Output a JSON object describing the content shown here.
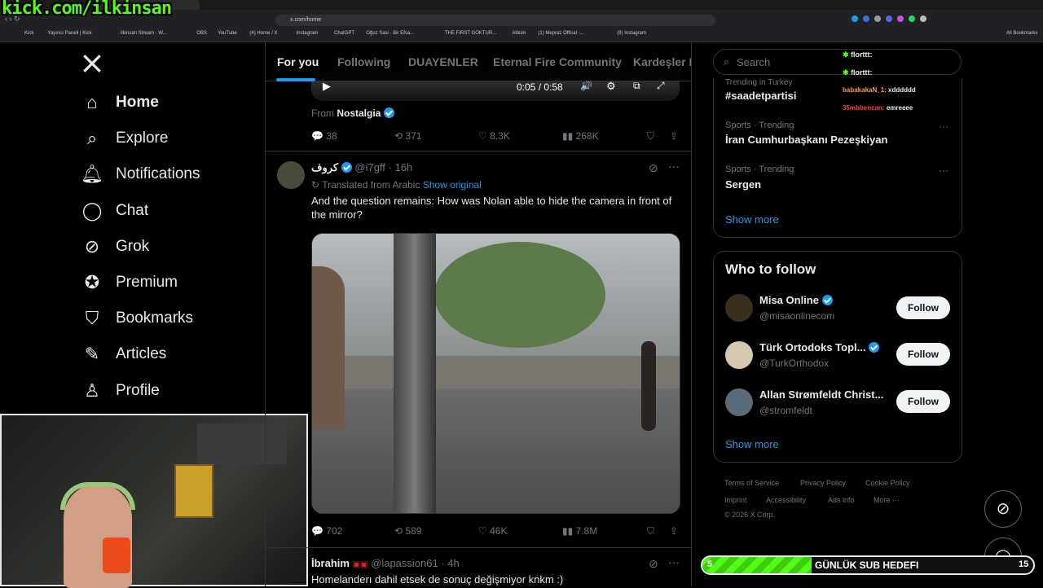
{
  "overlay": {
    "stream_url": "kick.com/ilkinsan",
    "chat_lines": [
      {
        "user": "florttt:",
        "msg": ""
      },
      {
        "user": "florttt:",
        "msg": ""
      },
      {
        "user": "babakakaN_1:",
        "msg": "xdddddd"
      },
      {
        "user": "35mbbencan:",
        "msg": "emreeee"
      }
    ],
    "goal_start": "5",
    "goal_label": "GÜNLÜK SUB HEDEFI",
    "goal_end": "15",
    "goal_progress": 0.33
  },
  "browser": {
    "url": "x.com/home",
    "bookmarks": [
      "Kick",
      "Yayıncı Paneli | Kick",
      "ilkinsan Stream - W...",
      "OBS",
      "YouTube",
      "(4) Home / X",
      "Instagram",
      "ChatGPT",
      "Oğuz Sasi - Bir Efsa...",
      "THE FIRST GOKTUR...",
      "Albüm",
      "(1) Mepraz Offical -...",
      "(9) Instagram"
    ],
    "all_bookmarks": "All Bookmarks"
  },
  "nav": {
    "items": [
      {
        "label": "Home",
        "icon": "home-icon"
      },
      {
        "label": "Explore",
        "icon": "search-icon"
      },
      {
        "label": "Notifications",
        "icon": "bell-icon"
      },
      {
        "label": "Chat",
        "icon": "chat-icon"
      },
      {
        "label": "Grok",
        "icon": "grok-icon"
      },
      {
        "label": "Premium",
        "icon": "premium-icon"
      },
      {
        "label": "Bookmarks",
        "icon": "bookmark-icon"
      },
      {
        "label": "Articles",
        "icon": "articles-icon"
      },
      {
        "label": "Profile",
        "icon": "profile-icon"
      }
    ]
  },
  "tabs": [
    "For you",
    "Following",
    "DUAYENLER",
    "Eternal Fire Community",
    "Kardeşler K"
  ],
  "tweet1": {
    "video_time": "0:05 / 0:58",
    "from_label": "From",
    "from_name": "Nostalgia",
    "replies": "38",
    "reposts": "371",
    "likes": "8.3K",
    "views": "268K"
  },
  "tweet2": {
    "name": "كروف",
    "handle": "@i7gff",
    "time": "· 16h",
    "translated": "Translated from Arabic",
    "show_original": "Show original",
    "text": "And the question remains: How was Nolan able to hide the camera in front of the mirror?",
    "replies": "702",
    "reposts": "589",
    "likes": "46K",
    "views": "7.8M"
  },
  "tweet3": {
    "name": "İbrahim",
    "handle": "@lapassion61",
    "time": "· 4h",
    "text": "Homelanderı dahil etsek de sonuç değişmiyor knkm :)"
  },
  "search": {
    "placeholder": "Search"
  },
  "trending": [
    {
      "context": "Trending in Turkey",
      "title": "#saadetpartisi"
    },
    {
      "context": "Sports · Trending",
      "title": "İran Cumhurbaşkanı Pezeşkiyan"
    },
    {
      "context": "Sports · Trending",
      "title": "Sergen"
    }
  ],
  "trending_show_more": "Show more",
  "who_to_follow": {
    "title": "Who to follow",
    "users": [
      {
        "name": "Misa Online",
        "handle": "@misaonlinecom",
        "button": "Follow"
      },
      {
        "name": "Türk Ortodoks Topl...",
        "handle": "@TurkOrthodox",
        "button": "Follow"
      },
      {
        "name": "Allan Strømfeldt Christ...",
        "handle": "@stromfeldt",
        "button": "Follow"
      }
    ],
    "show_more": "Show more"
  },
  "footer": {
    "links": [
      "Terms of Service",
      "Privacy Policy",
      "Cookie Policy",
      "Imprint",
      "Accessibility",
      "Ads info",
      "More ···"
    ],
    "copyright": "© 2026 X Corp."
  },
  "colors": {
    "accent": "#1d9bf0",
    "kick_green": "#53fc18",
    "background": "#000000"
  }
}
